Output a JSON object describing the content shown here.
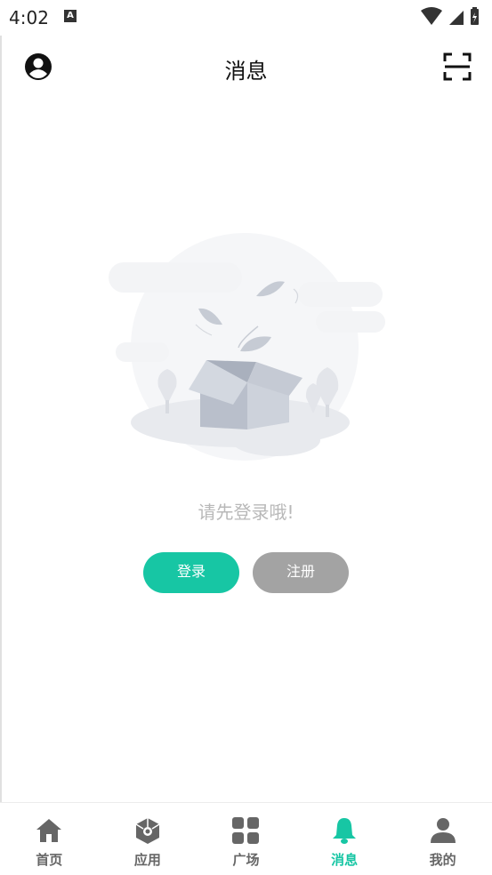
{
  "status_bar": {
    "time": "4:02",
    "notif_letter": "A"
  },
  "header": {
    "title": "消息"
  },
  "empty_state": {
    "message": "请先登录哦!"
  },
  "buttons": {
    "login": "登录",
    "register": "注册"
  },
  "tabs": [
    {
      "label": "首页",
      "icon": "home-icon",
      "active": false
    },
    {
      "label": "应用",
      "icon": "cube-icon",
      "active": false
    },
    {
      "label": "广场",
      "icon": "grid-icon",
      "active": false
    },
    {
      "label": "消息",
      "icon": "bell-icon",
      "active": true
    },
    {
      "label": "我的",
      "icon": "person-icon",
      "active": false
    }
  ],
  "colors": {
    "accent": "#17c6a4",
    "secondary_button": "#a3a3a3",
    "inactive_tab": "#666666"
  }
}
